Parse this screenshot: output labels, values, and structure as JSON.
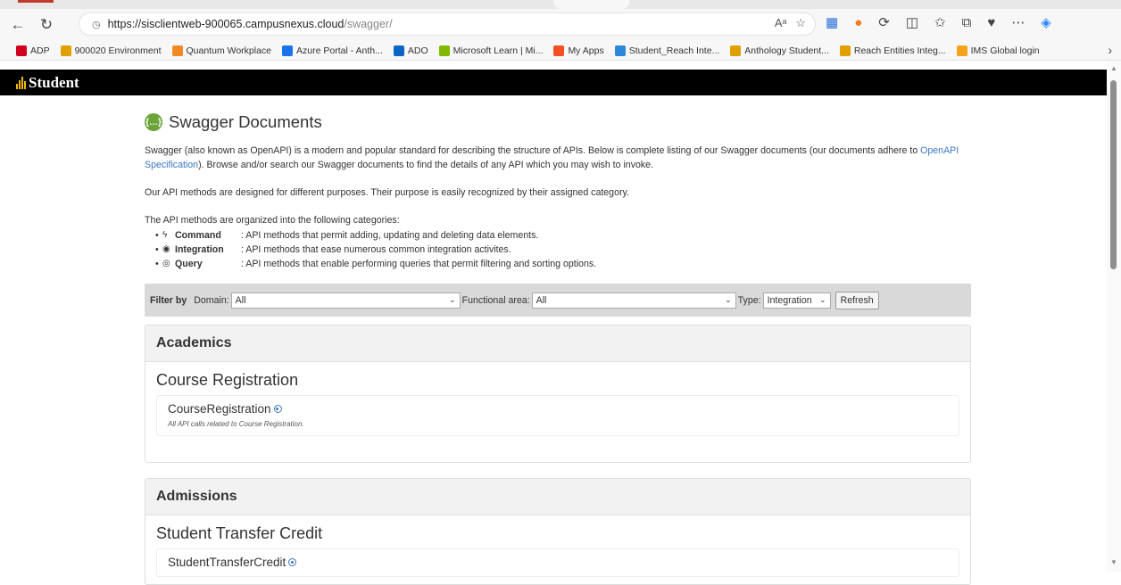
{
  "browser": {
    "url_main": "https://sisclientweb-900065.campusnexus.cloud",
    "url_path": "/swagger/",
    "read_aloud": "Aᵃ",
    "back_icon": "arrow-left-icon",
    "refresh_icon": "reload-icon"
  },
  "bookmarks": [
    {
      "label": "ADP",
      "color": "#d0021b"
    },
    {
      "label": "900020 Environment",
      "color": "#e0a000"
    },
    {
      "label": "Quantum Workplace",
      "color": "#f08a24"
    },
    {
      "label": "Azure Portal - Anth...",
      "color": "#1a73e8"
    },
    {
      "label": "ADO",
      "color": "#0b66c3"
    },
    {
      "label": "Microsoft Learn | Mi...",
      "color": "#7fba00"
    },
    {
      "label": "My Apps",
      "color": "#f25022"
    },
    {
      "label": "Student_Reach Inte...",
      "color": "#2b88d8"
    },
    {
      "label": "Anthology Student...",
      "color": "#e0a000"
    },
    {
      "label": "Reach Entities Integ...",
      "color": "#e0a000"
    },
    {
      "label": "IMS Global login",
      "color": "#f7a21b"
    }
  ],
  "app": {
    "logo_text": "Student"
  },
  "page": {
    "title": "Swagger Documents",
    "intro_1": "Swagger (also known as OpenAPI) is a modern and popular standard for describing the structure of APIs. Below is complete listing of our Swagger documents (our documents adhere to ",
    "intro_link": "OpenAPI Specification",
    "intro_2": "). Browse and/or search our Swagger documents to find the details of any API which you may wish to invoke.",
    "purpose": "Our API methods are designed for different purposes. Their purpose is easily recognized by their assigned category.",
    "organized": "The API methods are organized into the following categories:",
    "categories": [
      {
        "icon": "ϟ",
        "name": "Command",
        "desc": ": API methods that permit adding, updating and deleting data elements."
      },
      {
        "icon": "◉",
        "name": "Integration",
        "desc": ": API methods that ease numerous common integration activites."
      },
      {
        "icon": "◎",
        "name": "Query",
        "desc": ": API methods that enable performing queries that permit filtering and sorting options."
      }
    ]
  },
  "filter": {
    "label": "Filter by",
    "domain_label": "Domain:",
    "domain_value": "All",
    "area_label": "Functional area:",
    "area_value": "All",
    "type_label": "Type:",
    "type_value": "Integration",
    "refresh_label": "Refresh"
  },
  "sections": [
    {
      "heading": "Academics",
      "area": "Course Registration",
      "api_name": "CourseRegistration",
      "api_desc": "All API calls related to Course Registration."
    },
    {
      "heading": "Admissions",
      "area": "Student Transfer Credit",
      "api_name": "StudentTransferCredit"
    }
  ]
}
